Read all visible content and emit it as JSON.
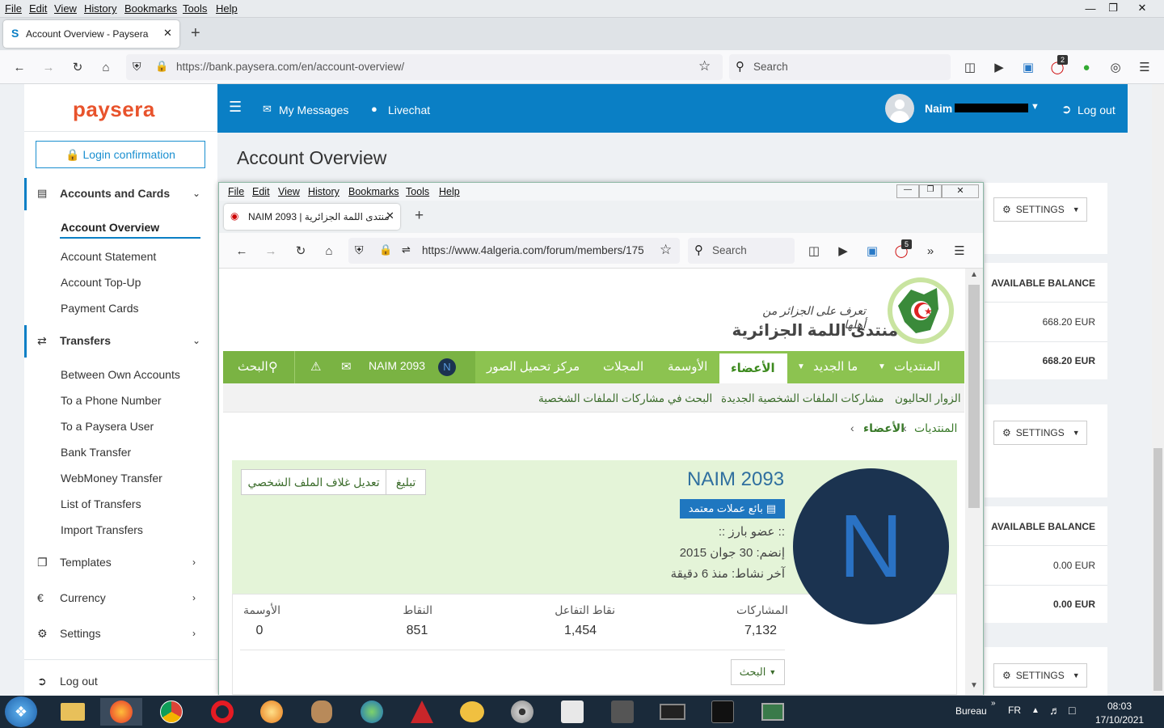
{
  "outer_browser": {
    "menu": [
      "File",
      "Edit",
      "View",
      "History",
      "Bookmarks",
      "Tools",
      "Help"
    ],
    "tab_title": "Account Overview - Paysera",
    "url": "https://bank.paysera.com/en/account-overview/",
    "search_placeholder": "Search",
    "badge_count": "2"
  },
  "paysera": {
    "logo": "paysera",
    "login_confirmation": "Login confirmation",
    "nav": {
      "accounts_and_cards": "Accounts and Cards",
      "account_overview": "Account Overview",
      "account_statement": "Account Statement",
      "account_topup": "Account Top-Up",
      "payment_cards": "Payment Cards",
      "transfers": "Transfers",
      "between_own": "Between Own Accounts",
      "to_phone": "To a Phone Number",
      "to_paysera_user": "To a Paysera User",
      "bank_transfer": "Bank Transfer",
      "webmoney": "WebMoney Transfer",
      "list_transfers": "List of Transfers",
      "import_transfers": "Import Transfers",
      "templates": "Templates",
      "currency": "Currency",
      "settings": "Settings",
      "logout": "Log out"
    },
    "header": {
      "my_messages": "My Messages",
      "livechat": "Livechat",
      "user": "Naim",
      "logout": "Log out"
    },
    "page_title": "Account Overview",
    "accounts": [
      {
        "settings": "SETTINGS",
        "available_balance": "AVAILABLE BALANCE",
        "amount": "668.20 EUR",
        "total": "668.20 EUR"
      },
      {
        "settings": "SETTINGS",
        "available_balance": "AVAILABLE BALANCE",
        "amount": "0.00 EUR",
        "total": "0.00 EUR"
      },
      {
        "settings": "SETTINGS"
      }
    ]
  },
  "inner_browser": {
    "menu": [
      "File",
      "Edit",
      "View",
      "History",
      "Bookmarks",
      "Tools",
      "Help"
    ],
    "tab_title": "NAIM 2093 | منتدى اللمة الجزائرية",
    "url": "https://www.4algeria.com/forum/members/175",
    "search_placeholder": "Search",
    "badge_count": "5"
  },
  "forum": {
    "logo_tagline": "تعرف على الجزائر من أهلها",
    "logo_name": "منتدى اللمة الجزائرية",
    "nav": {
      "forums": "المنتديات",
      "whats_new": "ما الجديد",
      "members": "الأعضاء",
      "medals": "الأوسمة",
      "magazines": "المجلات",
      "upload": "مركز تحميل الصور",
      "username": "NAIM 2093",
      "avatar_letter": "N",
      "search": "البحث"
    },
    "sub": {
      "current_visitors": "الزوار الحاليون",
      "new_posts": "مشاركات الملفات الشخصية الجديدة",
      "search_posts": "البحث في مشاركات الملفات الشخصية"
    },
    "breadcrumb": {
      "forums": "المنتديات",
      "members": "الأعضاء"
    },
    "profile": {
      "name": "NAIM 2093",
      "badge": "بائع عملات معتمد",
      "rank": ":: عضو بارز ::",
      "joined": "إنضم: 30 جوان 2015",
      "last_active": "آخر نشاط: منذ 6 دقيقة",
      "report": "تبليغ",
      "edit_cover": "تعديل غلاف الملف الشخصي",
      "avatar_letter": "N"
    },
    "stats": [
      {
        "label": "المشاركات",
        "value": "7,132"
      },
      {
        "label": "نقاط التفاعل",
        "value": "1,454"
      },
      {
        "label": "النقاط",
        "value": "851"
      },
      {
        "label": "الأوسمة",
        "value": "0"
      }
    ],
    "search_btn": "البحث"
  },
  "taskbar": {
    "bureau": "Bureau",
    "lang": "FR",
    "time": "08:03",
    "date": "17/10/2021"
  },
  "colors": {
    "paysera_blue": "#0a7fc5",
    "forum_green": "#8cc350",
    "avatar_dark": "#1b3350",
    "avatar_letter": "#2a72c4"
  }
}
